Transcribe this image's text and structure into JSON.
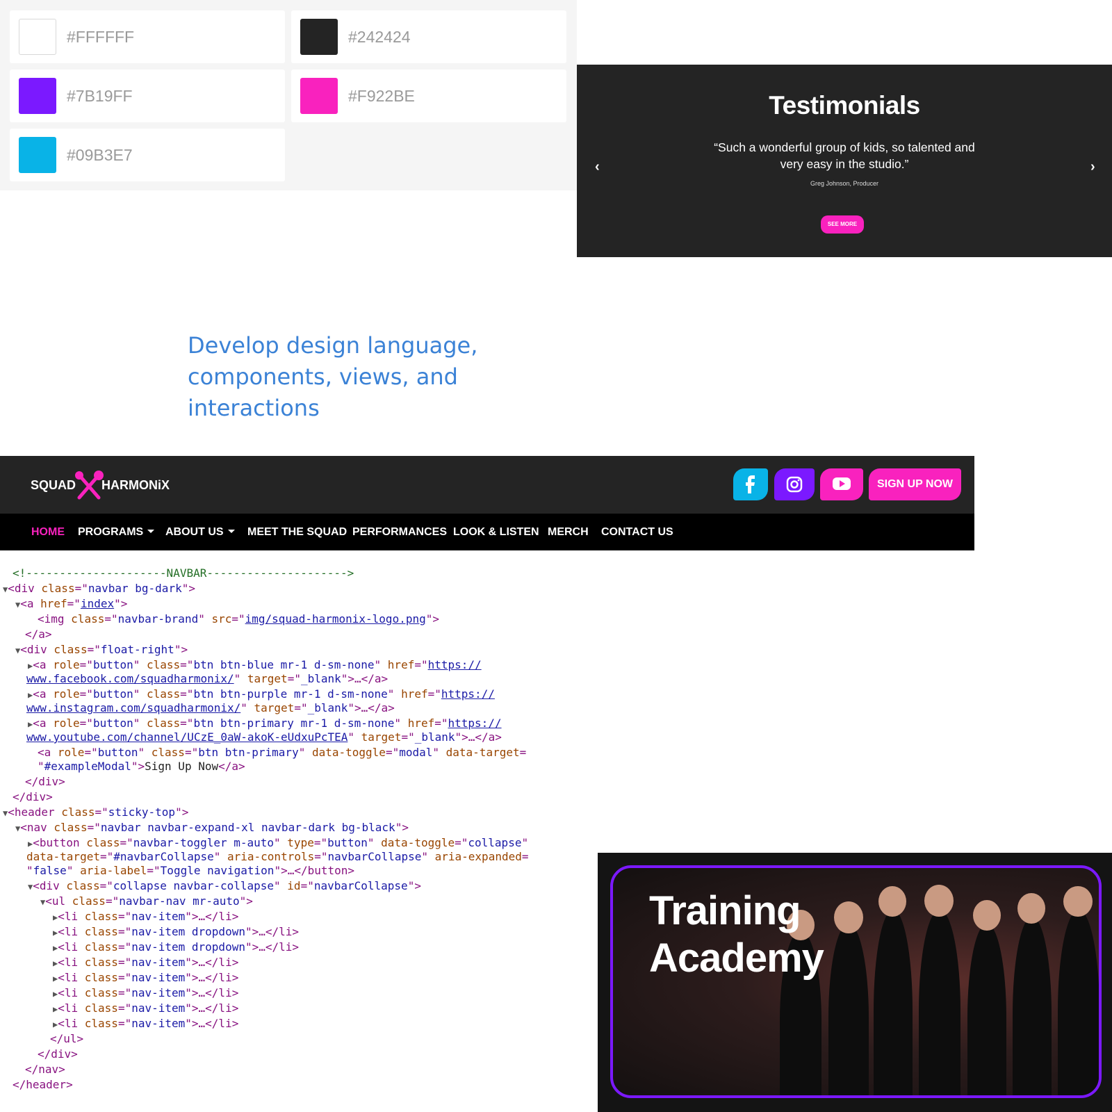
{
  "swatches": [
    {
      "hex": "#FFFFFF",
      "color": "#FFFFFF"
    },
    {
      "hex": "#242424",
      "color": "#242424"
    },
    {
      "hex": "#7B19FF",
      "color": "#7B19FF"
    },
    {
      "hex": "#F922BE",
      "color": "#F922BE"
    },
    {
      "hex": "#09B3E7",
      "color": "#09B3E7"
    }
  ],
  "testimonials": {
    "title": "Testimonials",
    "quote": "“Such a wonderful group of kids, so talented and very easy in the studio.”",
    "author": "Greg Johnson, Producer",
    "button": "SEE MORE",
    "prev_icon": "chevron-left-icon",
    "next_icon": "chevron-right-icon"
  },
  "headline": {
    "line1": "Develop design language,",
    "line2": "components, views, and interactions"
  },
  "navbar": {
    "logo_left": "SQUAD",
    "logo_right": "HARMONiX",
    "social": [
      "facebook-icon",
      "instagram-icon",
      "youtube-icon"
    ],
    "signup": "SIGN UP NOW",
    "items": [
      {
        "label": "HOME"
      },
      {
        "label": "PROGRAMS"
      },
      {
        "label": "ABOUT US"
      },
      {
        "label": "MEET THE SQUAD"
      },
      {
        "label": "PERFORMANCES"
      },
      {
        "label": "LOOK & LISTEN"
      },
      {
        "label": "MERCH"
      },
      {
        "label": "CONTACT US"
      }
    ],
    "colors": {
      "bar": "#242424",
      "nav": "#000000",
      "accent": "#F922BE",
      "blue": "#09B3E7",
      "purple": "#7B19FF"
    }
  },
  "code": {
    "comment": "<!---------------------NAVBAR--------------------->",
    "c1_tag": "div",
    "c1_attr": "class",
    "c1_val": "navbar bg-dark",
    "c2_attr": "href",
    "c2_val": "index",
    "c3_attr1": "class",
    "c3_val1": "navbar-brand",
    "c3_attr2": "src",
    "c3_val2": "img/squad-harmonix-logo.png",
    "c5_val": "float-right",
    "fb_class": "btn btn-blue mr-1 d-sm-none",
    "fb_href1": "https://",
    "fb_href2": "www.facebook.com/squadharmonix/",
    "ig_class": "btn btn-purple mr-1 d-sm-none",
    "ig_href1": "https://",
    "ig_href2": "www.instagram.com/squadharmonix/",
    "yt_class": "btn btn-primary mr-1 d-sm-none",
    "yt_href1": "https://",
    "yt_href2": "www.youtube.com/channel/UCzE_0aW-akoK-eUdxuPcTEA",
    "target": "_blank",
    "role": "button",
    "su_class": "btn btn-primary",
    "su_toggle": "modal",
    "su_target": "#exampleModal",
    "su_text": "Sign Up Now",
    "header_class": "sticky-top",
    "nav_class": "navbar navbar-expand-xl navbar-dark bg-black",
    "btn_class": "navbar-toggler m-auto",
    "btn_type": "button",
    "btn_toggle": "collapse",
    "btn_target": "#navbarCollapse",
    "btn_controls": "navbarCollapse",
    "btn_expanded": "false",
    "btn_label": "Toggle navigation",
    "coll_class": "collapse navbar-collapse",
    "coll_id": "navbarCollapse",
    "ul_class": "navbar-nav mr-auto",
    "li": "nav-item",
    "li_dd": "nav-item dropdown"
  },
  "training": {
    "title_line1": "Training",
    "title_line2": "Academy"
  }
}
